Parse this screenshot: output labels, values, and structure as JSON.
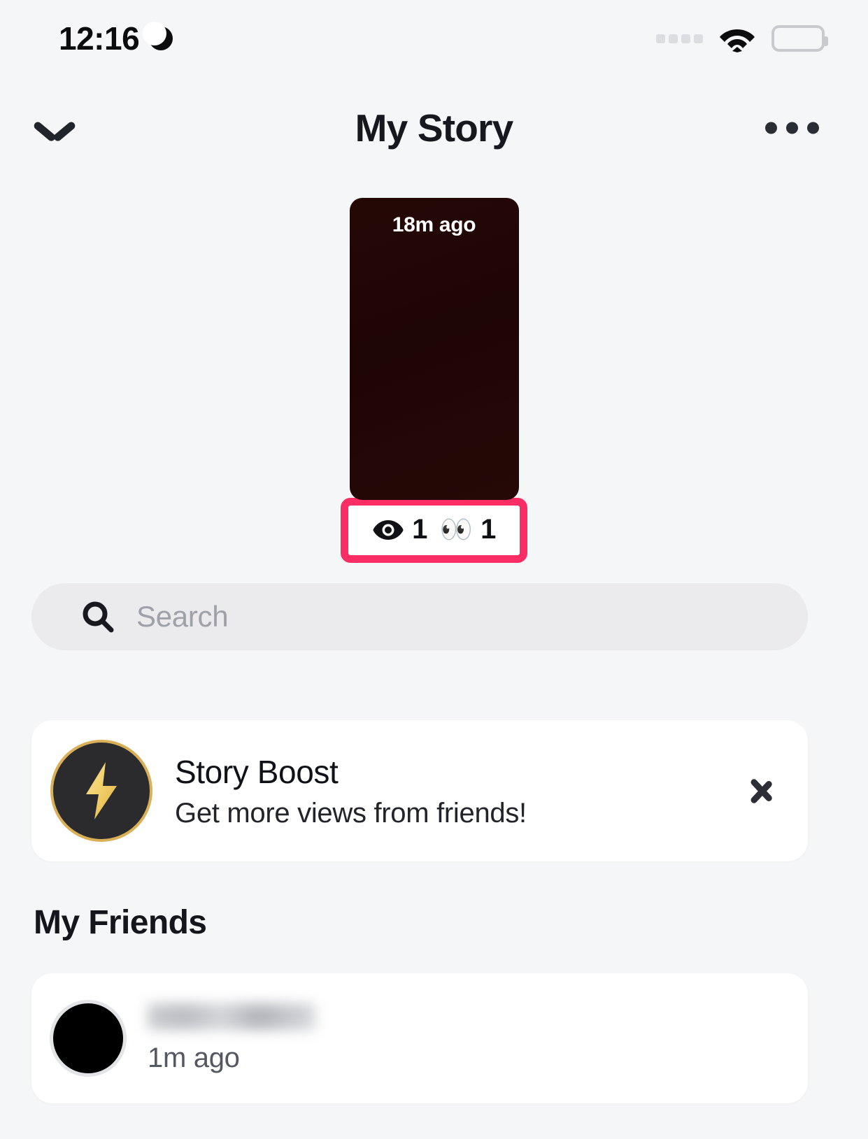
{
  "status_bar": {
    "time": "12:16",
    "moon_icon": "crescent-moon-icon",
    "signal_icon": "signal-dots-icon",
    "wifi_icon": "wifi-icon",
    "battery_icon": "battery-full-icon"
  },
  "nav": {
    "back_icon": "chevron-down-icon",
    "title": "My Story",
    "more_icon": "more-horizontal-icon"
  },
  "story": {
    "timestamp": "18m ago",
    "thumbnail_color": "#230706",
    "highlight_color": "#FA2E64",
    "views": {
      "view_icon": "eye-icon",
      "view_count": "1",
      "screenshot_icon": "eyes-emoji-icon",
      "screenshot_count": "1"
    }
  },
  "search": {
    "icon": "search-icon",
    "placeholder": "Search",
    "value": ""
  },
  "story_boost": {
    "icon": "lightning-bolt-icon",
    "title": "Story Boost",
    "subtitle": "Get more views from friends!",
    "chevron_icon": "chevron-right-icon",
    "accent_color": "#D9B057"
  },
  "friends": {
    "section_title": "My Friends",
    "items": [
      {
        "avatar_icon": "avatar",
        "name": "",
        "name_redacted": true,
        "time": "1m ago"
      }
    ]
  }
}
